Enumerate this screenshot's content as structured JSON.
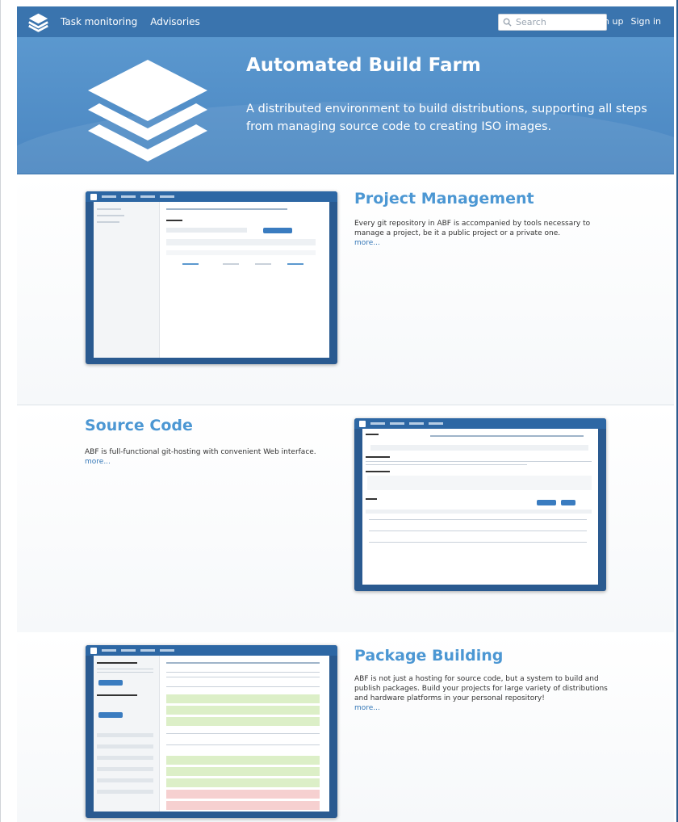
{
  "header": {
    "nav_items": [
      "Task monitoring",
      "Advisories"
    ],
    "search_placeholder": "Search",
    "sign_up": "Sign up",
    "sign_in": "Sign in"
  },
  "hero": {
    "title": "Automated Build Farm",
    "subtitle": "A distributed environment to build distributions, supporting all steps from managing source code to creating ISO images."
  },
  "features": [
    {
      "title": "Project Management",
      "text": "Every git repository in ABF is accompanied by tools necessary to manage a project, be it a public project or a private one.",
      "more": "more..."
    },
    {
      "title": "Source Code",
      "text": "ABF is full-functional git-hosting with convenient Web interface.",
      "more": "more..."
    },
    {
      "title": "Package Building",
      "text": "ABF is not just a hosting for source code, but a system to build and publish packages. Build your projects for large variety of distributions and hardware platforms in your personal repository!",
      "more": "more..."
    }
  ],
  "colors": {
    "nav_bar": "#3a74ae",
    "hero_bg": "#5b98cf",
    "feature_title": "#4c97d3",
    "link": "#3477b7"
  },
  "icons": {
    "logo": "stacked-layers-icon",
    "search": "magnifier-icon"
  }
}
